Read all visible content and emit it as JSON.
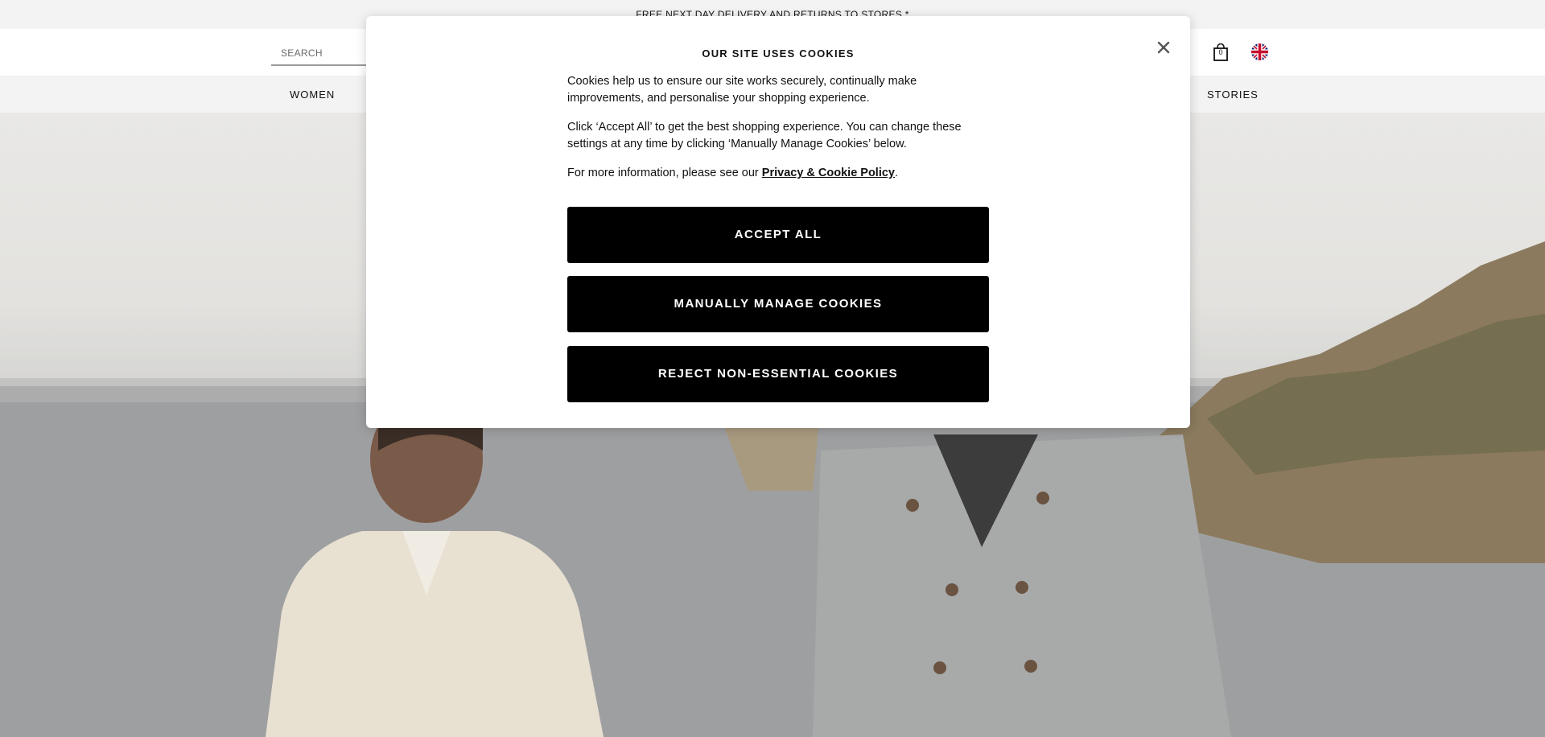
{
  "announcement": {
    "text": "FREE NEXT DAY DELIVERY AND RETURNS TO STORES *"
  },
  "header": {
    "search_placeholder": "SEARCH",
    "bag_count": "0"
  },
  "nav": {
    "items": [
      {
        "label": "WOMEN"
      },
      {
        "label": "STORIES"
      }
    ]
  },
  "cookie_modal": {
    "title": "OUR SITE USES COOKIES",
    "paragraph_1": "Cookies help us to ensure our site works securely, continually make improvements, and personalise your shopping experience.",
    "paragraph_2": "Click ‘Accept All’ to get the best shopping experience. You can change these settings at any time by clicking ‘Manually Manage Cookies’ below.",
    "paragraph_3_prefix": "For more information, please see our ",
    "policy_link": "Privacy & Cookie Policy",
    "paragraph_3_suffix": ".",
    "accept_all": "ACCEPT ALL",
    "manage": "MANUALLY MANAGE COOKIES",
    "reject": "REJECT NON-ESSENTIAL COOKIES"
  },
  "icons": {
    "close": "close-icon",
    "bag": "shopping-bag-icon",
    "flag": "uk-flag-icon"
  }
}
